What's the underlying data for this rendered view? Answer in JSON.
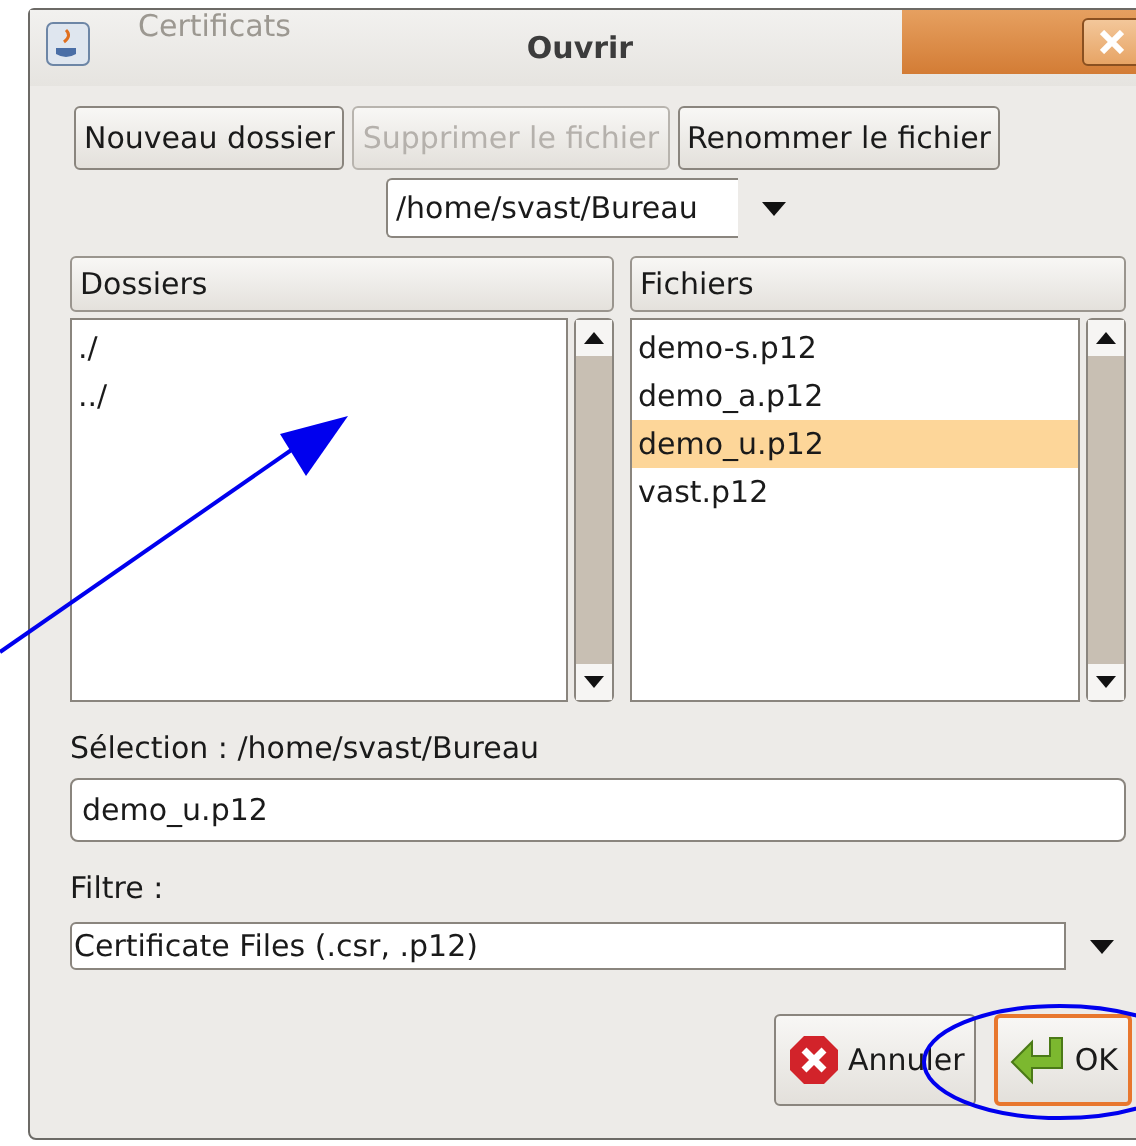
{
  "background_window": {
    "title": "Certificats"
  },
  "dialog": {
    "title": "Ouvrir"
  },
  "toolbar_buttons": [
    {
      "label": "Nouveau dossier",
      "disabled": false
    },
    {
      "label": "Supprimer le fichier",
      "disabled": true
    },
    {
      "label": "Renommer le fichier",
      "disabled": false
    }
  ],
  "path_combo": {
    "value": "/home/svast/Bureau"
  },
  "folders": {
    "header": "Dossiers",
    "items": [
      {
        "name": "./",
        "selected": false
      },
      {
        "name": "../",
        "selected": false
      }
    ]
  },
  "files": {
    "header": "Fichiers",
    "items": [
      {
        "name": "demo-s.p12",
        "selected": false
      },
      {
        "name": "demo_a.p12",
        "selected": false
      },
      {
        "name": "demo_u.p12",
        "selected": true
      },
      {
        "name": "vast.p12",
        "selected": false
      }
    ]
  },
  "selection": {
    "label": "Sélection : /home/svast/Bureau",
    "value": "demo_u.p12"
  },
  "filter": {
    "label": "Filtre :",
    "value": "Certificate Files (.csr, .p12)"
  },
  "buttons": [
    {
      "label": "Annuler",
      "kind": "cancel",
      "default": false
    },
    {
      "label": "OK",
      "kind": "ok",
      "default": true
    }
  ]
}
